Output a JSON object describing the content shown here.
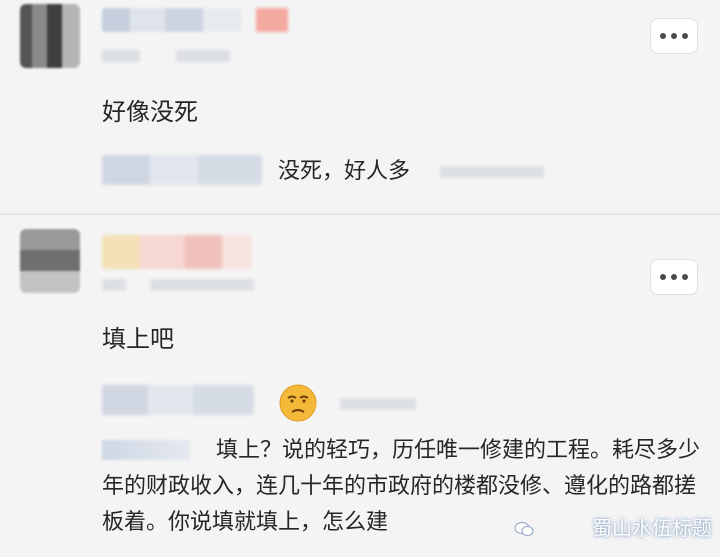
{
  "comments": [
    {
      "text": "好像没死",
      "reply": {
        "text": "没死，好人多"
      }
    },
    {
      "text": "填上吧",
      "reply": {
        "emoji": "unamused-face-icon",
        "text": "填上？说的轻巧，历任唯一修建的工程。耗尽多少年的财政收入，连几十年的市政府的楼都没修、遵化的路都搓板着。你说填就填上，怎么建"
      }
    }
  ],
  "watermark": "蜀山水伍标题",
  "icons": {
    "more": "more-options-icon",
    "watermark": "wechat-logo-icon"
  },
  "colors": {
    "background": "#f4f4f4",
    "text": "#262626",
    "emoji_face": "#f5b93a"
  }
}
